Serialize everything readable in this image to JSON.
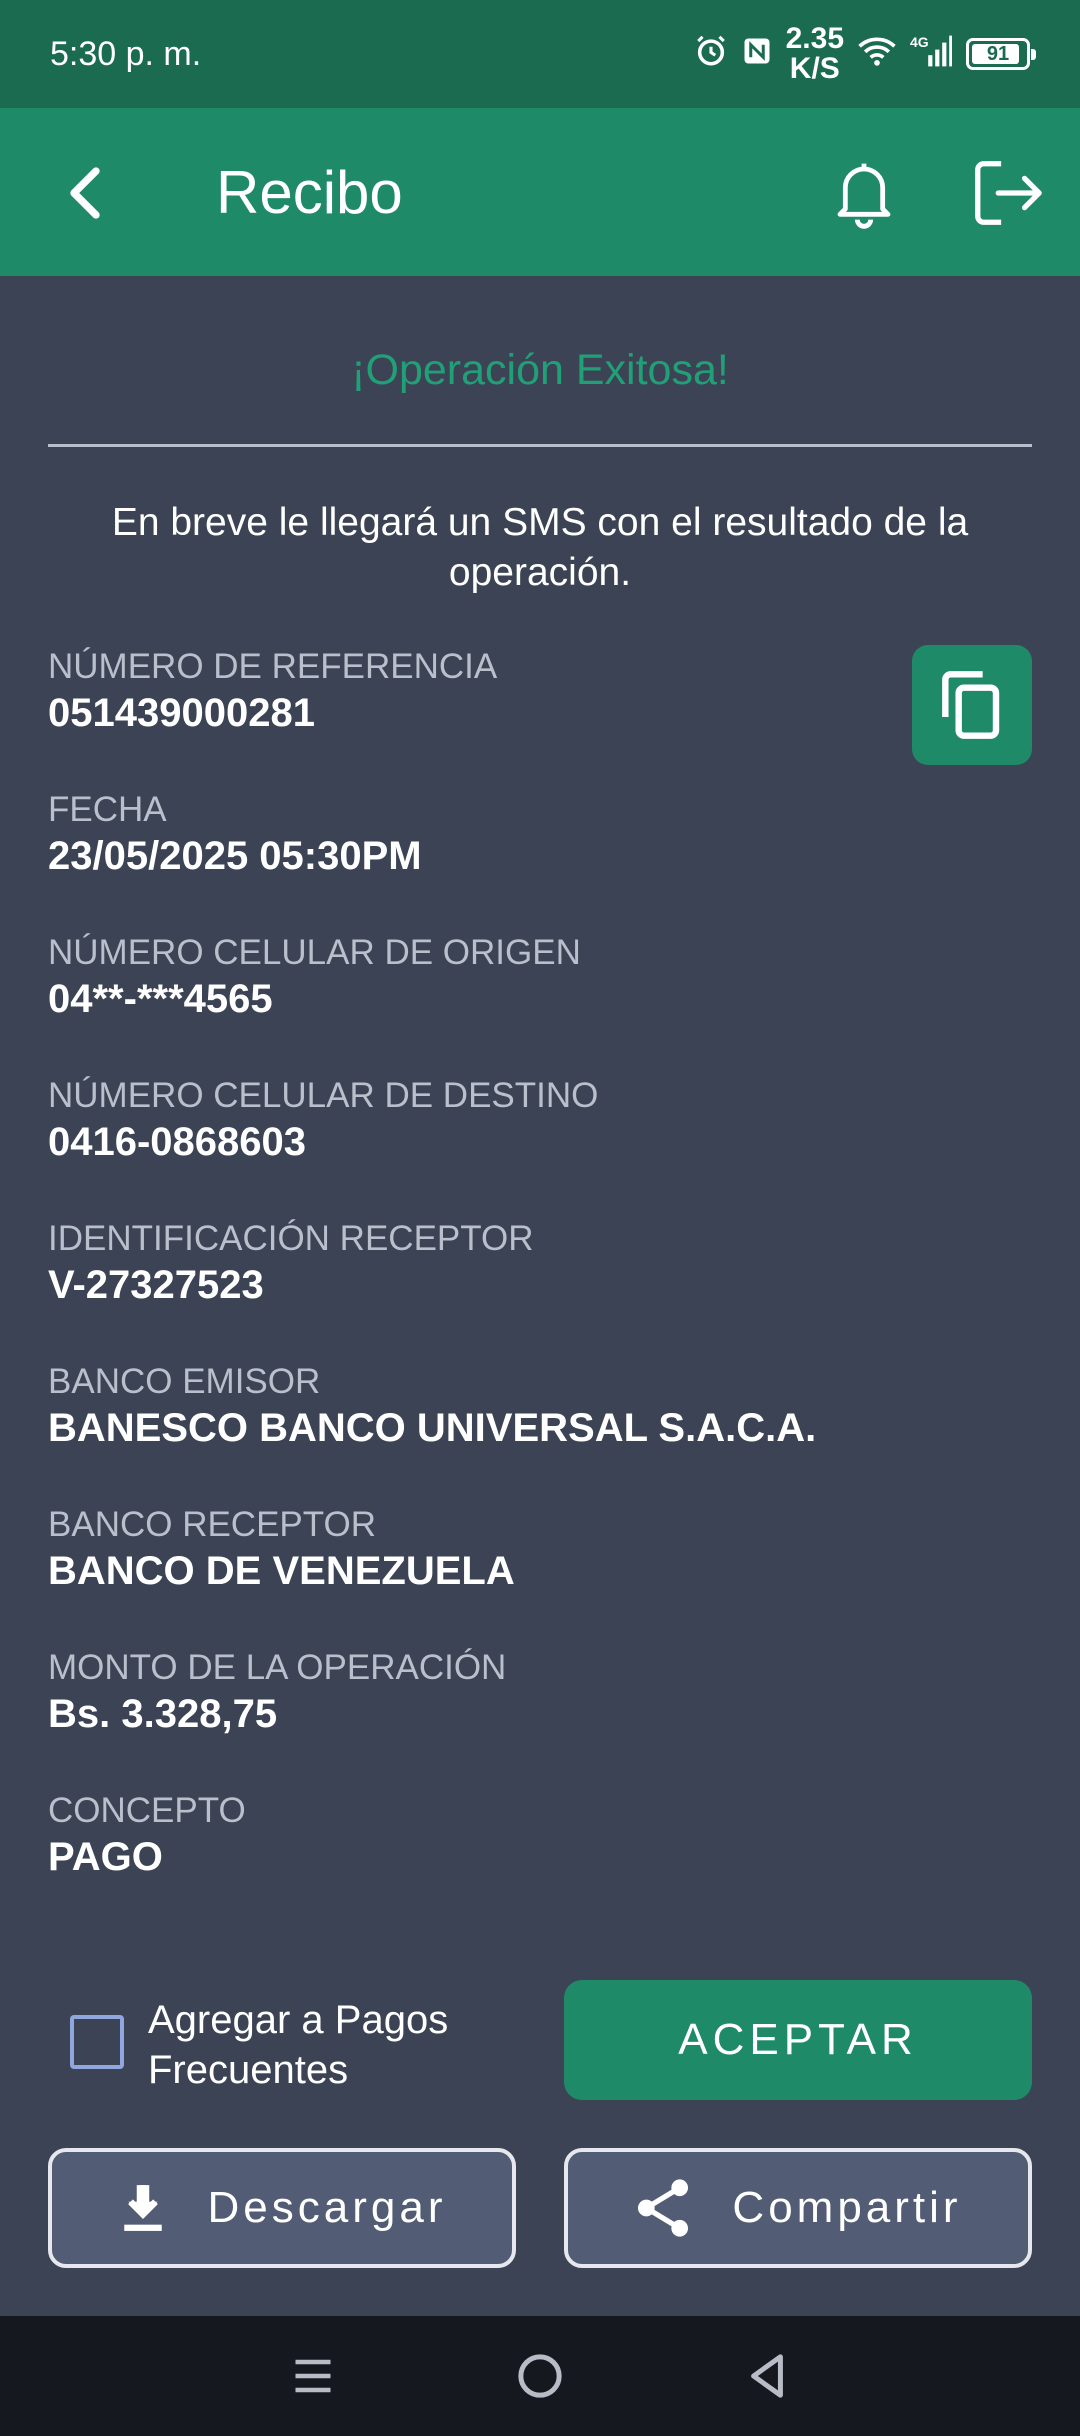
{
  "status_bar": {
    "time": "5:30 p. m.",
    "speed_value": "2.35",
    "speed_unit": "K/S",
    "network": "4G",
    "battery": "91",
    "icons": [
      "alarm-icon",
      "nfc-icon",
      "wifi-icon",
      "signal-icon",
      "battery-icon"
    ]
  },
  "app_bar": {
    "title": "Recibo",
    "icons": [
      "back-arrow-icon",
      "bell-icon",
      "logout-icon"
    ]
  },
  "receipt": {
    "success_title": "¡Operación Exitosa!",
    "sms_note": "En breve le llegará un SMS con el resultado de la operación.",
    "fields": [
      {
        "label": "NÚMERO DE REFERENCIA",
        "value": "051439000281"
      },
      {
        "label": "FECHA",
        "value": "23/05/2025 05:30PM"
      },
      {
        "label": "NÚMERO CELULAR DE ORIGEN",
        "value": "04**-***4565"
      },
      {
        "label": "NÚMERO CELULAR DE DESTINO",
        "value": "0416-0868603"
      },
      {
        "label": "IDENTIFICACIÓN RECEPTOR",
        "value": "V-27327523"
      },
      {
        "label": "BANCO EMISOR",
        "value": "BANESCO BANCO UNIVERSAL S.A.C.A."
      },
      {
        "label": "BANCO RECEPTOR",
        "value": "BANCO DE VENEZUELA"
      },
      {
        "label": "MONTO DE LA OPERACIÓN",
        "value": "Bs. 3.328,75"
      },
      {
        "label": "CONCEPTO",
        "value": "PAGO"
      }
    ]
  },
  "actions": {
    "frequent_checkbox_label": "Agregar a Pagos Frecuentes",
    "frequent_checked": false,
    "accept_label": "ACEPTAR",
    "download_label": "Descargar",
    "share_label": "Compartir"
  },
  "colors": {
    "status_bar": "#1a6b4f",
    "app_bar": "#1f8a68",
    "background": "#3b4354",
    "success_text": "#21a077",
    "label_text": "#b9bfcb"
  }
}
